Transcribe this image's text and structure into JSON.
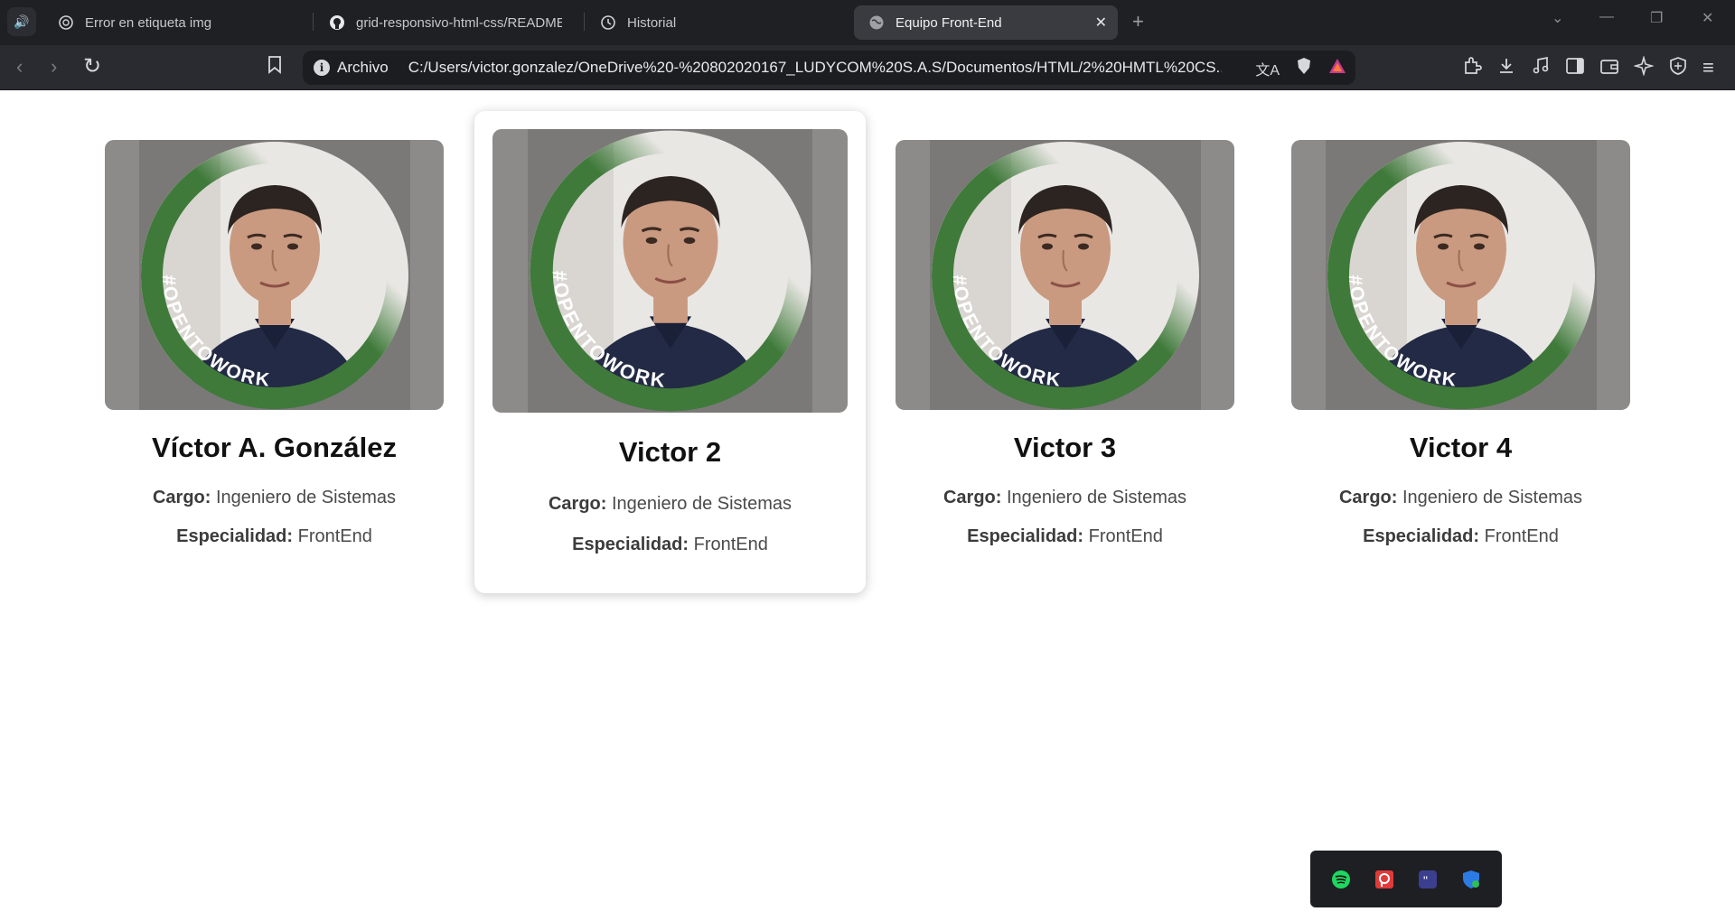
{
  "browser": {
    "tabs": [
      {
        "label": "Error en etiqueta img",
        "icon": "openai-icon",
        "active": false
      },
      {
        "label": "grid-responsivo-html-css/README.md",
        "icon": "github-icon",
        "active": false
      },
      {
        "label": "Historial",
        "icon": "history-icon",
        "active": false
      },
      {
        "label": "Equipo Front-End",
        "icon": "globe-icon",
        "active": true
      }
    ],
    "address": {
      "scheme_label": "Archivo",
      "url": "C:/Users/victor.gonzalez/OneDrive%20-%20802020167_LUDYCOM%20S.A.S/Documentos/HTML/2%20HMTL%20CS..."
    }
  },
  "team": [
    {
      "name": "Víctor A. González",
      "cargo_label": "Cargo:",
      "cargo": "Ingeniero de Sistemas",
      "especialidad_label": "Especialidad:",
      "especialidad": "FrontEnd",
      "photo_badge": "#OPENTOWORK"
    },
    {
      "name": "Victor 2",
      "cargo_label": "Cargo:",
      "cargo": "Ingeniero de Sistemas",
      "especialidad_label": "Especialidad:",
      "especialidad": "FrontEnd",
      "photo_badge": "#OPENTOWORK"
    },
    {
      "name": "Victor 3",
      "cargo_label": "Cargo:",
      "cargo": "Ingeniero de Sistemas",
      "especialidad_label": "Especialidad:",
      "especialidad": "FrontEnd",
      "photo_badge": "#OPENTOWORK"
    },
    {
      "name": "Victor 4",
      "cargo_label": "Cargo:",
      "cargo": "Ingeniero de Sistemas",
      "especialidad_label": "Especialidad:",
      "especialidad": "FrontEnd",
      "photo_badge": "#OPENTOWORK"
    }
  ],
  "colors": {
    "badge_green": "#3f7a3a",
    "shirt_navy": "#232a45",
    "skin": "#c99a80",
    "hair": "#2b2421"
  },
  "dock_icons": [
    "spotify-icon",
    "pocketcasts-icon",
    "quotes-app-icon",
    "shield-check-icon"
  ]
}
